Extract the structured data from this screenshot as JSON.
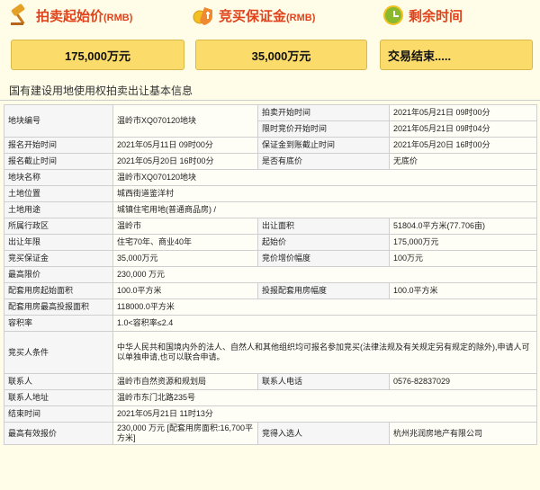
{
  "summary": {
    "start_price": {
      "label": "拍卖起始价",
      "unit": "(RMB)",
      "value": "175,000万元"
    },
    "deposit": {
      "label": "竞买保证金",
      "unit": "(RMB)",
      "value": "35,000万元"
    },
    "remaining": {
      "label": "剩余时间",
      "value": "交易结束....."
    }
  },
  "section_title": "国有建设用地使用权拍卖出让基本信息",
  "rows": [
    {
      "c1": "地块编号",
      "c2": "温岭市XQ070120地块",
      "c3": "拍卖开始时间",
      "c4": "2021年05月21日 09时00分"
    },
    {
      "c1": "",
      "c2": "",
      "c3": "限时竞价开始时间",
      "c4": "2021年05月21日 09时04分"
    },
    {
      "c1": "报名开始时间",
      "c2": "2021年05月11日 09时00分",
      "c3": "保证金到账截止时间",
      "c4": "2021年05月20日 16时00分"
    },
    {
      "c1": "报名截止时间",
      "c2": "2021年05月20日 16时00分",
      "c3": "是否有底价",
      "c4": "无底价"
    },
    {
      "c1": "地块名称",
      "c2": "温岭市XQ070120地块"
    },
    {
      "c1": "土地位置",
      "c2": "城西街道鉴洋村"
    },
    {
      "c1": "土地用途",
      "c2": "城镇住宅用地(普通商品房) /"
    },
    {
      "c1": "所属行政区",
      "c2": "温岭市",
      "c3": "出让面积",
      "c4": "51804.0平方米(77.706亩)"
    },
    {
      "c1": "出让年限",
      "c2": "住宅70年、商业40年",
      "c3": "起始价",
      "c4": "175,000万元"
    },
    {
      "c1": "竞买保证金",
      "c2": "35,000万元",
      "c3": "竞价增价幅度",
      "c4": "100万元"
    },
    {
      "c1": "最高限价",
      "c2": "230,000 万元"
    },
    {
      "c1": "配套用房起始面积",
      "c2": "100.0平方米",
      "c3": "投报配套用房幅度",
      "c4": "100.0平方米"
    },
    {
      "c1": "配套用房最高投报面积",
      "c2": "118000.0平方米"
    },
    {
      "c1": "容积率",
      "c2": "1.0<容积率≤2.4"
    },
    {
      "c1": "竞买人条件",
      "c2": "中华人民共和国境内外的法人、自然人和其他组织均可报名参加竞买(法律法规及有关规定另有规定的除外),申请人可以单独申请,也可以联合申请。"
    },
    {
      "c1": "联系人",
      "c2": "温岭市自然资源和规划局",
      "c3": "联系人电话",
      "c4": "0576-82837029"
    },
    {
      "c1": "联系人地址",
      "c2": "温岭市东门北路235号"
    },
    {
      "c1": "结束时间",
      "c2": "2021年05月21日 11时13分"
    },
    {
      "c1": "最高有效报价",
      "c2": "230,000 万元 [配套用房面积:16,700平方米]",
      "c3": "竞得入选人",
      "c4": "杭州兆润房地产有限公司"
    }
  ],
  "icons": {
    "start_price": "auction-hammer-icon",
    "deposit": "deposit-money-icon",
    "remaining": "clock-icon"
  },
  "colors": {
    "accent": "#e0431c",
    "box": "#fbdc6a",
    "background": "#fffde8"
  }
}
